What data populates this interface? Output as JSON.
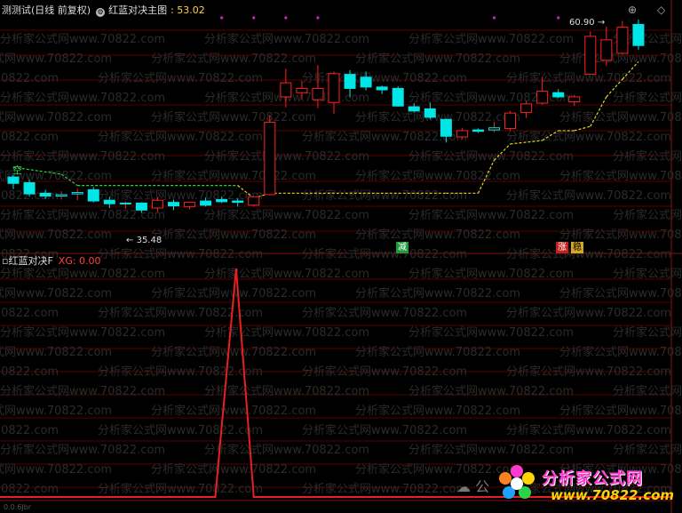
{
  "main_panel": {
    "title_prefix": "测测试(日线 前复权)",
    "indicator_name": "红蓝对决主图",
    "indicator_value_label": ": 53.02",
    "high_label": "60.90",
    "low_label": "35.48",
    "signal_label_kong": "空",
    "marker_jian": "减",
    "marker_zhang": "涨",
    "marker_wen": "稳"
  },
  "sub_panel": {
    "title": "红蓝对决F",
    "value_label": "XG: 0.00"
  },
  "window_controls": {
    "restore": "⊕",
    "close": "◇"
  },
  "watermark": {
    "repeat_text": "分析家公式网www.70822.com",
    "wechat_text": "公",
    "brand": "分析家公式网",
    "site": "www.70822.com"
  },
  "footer_label": "0.0.6Jbr",
  "colors": {
    "up": "#ff2020",
    "down": "#00e5e5",
    "stop_line_green": "#2bd34a",
    "stop_line_yellow": "#e8d420",
    "xg_line": "#e82020",
    "grid": "#5a0000",
    "magenta_dot": "#d020d0"
  },
  "chart_data": {
    "type": "candlestick",
    "candles": [
      {
        "o": 40.6,
        "h": 40.9,
        "l": 38.9,
        "c": 39.7
      },
      {
        "o": 39.8,
        "h": 40.3,
        "l": 37.8,
        "c": 38.2
      },
      {
        "o": 38.3,
        "h": 38.8,
        "l": 37.5,
        "c": 37.9
      },
      {
        "o": 37.9,
        "h": 38.6,
        "l": 37.4,
        "c": 38.1
      },
      {
        "o": 38.2,
        "h": 38.9,
        "l": 37.3,
        "c": 38.4
      },
      {
        "o": 38.8,
        "h": 39.2,
        "l": 37.0,
        "c": 37.2
      },
      {
        "o": 37.3,
        "h": 37.8,
        "l": 36.2,
        "c": 36.8
      },
      {
        "o": 36.8,
        "h": 37.1,
        "l": 36.1,
        "c": 36.9
      },
      {
        "o": 36.9,
        "h": 37.0,
        "l": 35.5,
        "c": 35.9
      },
      {
        "o": 36.2,
        "h": 37.7,
        "l": 35.6,
        "c": 37.3
      },
      {
        "o": 37.0,
        "h": 37.4,
        "l": 35.9,
        "c": 36.5
      },
      {
        "o": 36.4,
        "h": 37.0,
        "l": 36.0,
        "c": 37.0
      },
      {
        "o": 37.2,
        "h": 37.7,
        "l": 36.4,
        "c": 36.6
      },
      {
        "o": 37.4,
        "h": 37.8,
        "l": 36.9,
        "c": 37.1
      },
      {
        "o": 37.2,
        "h": 37.6,
        "l": 36.4,
        "c": 37.0
      },
      {
        "o": 36.6,
        "h": 37.9,
        "l": 36.4,
        "c": 37.8
      },
      {
        "o": 38.1,
        "h": 49.4,
        "l": 38.0,
        "c": 48.4
      },
      {
        "o": 52.0,
        "h": 56.0,
        "l": 50.5,
        "c": 54.0
      },
      {
        "o": 52.6,
        "h": 54.3,
        "l": 51.6,
        "c": 53.2
      },
      {
        "o": 51.6,
        "h": 56.5,
        "l": 50.4,
        "c": 53.2
      },
      {
        "o": 51.2,
        "h": 55.6,
        "l": 49.6,
        "c": 55.3
      },
      {
        "o": 55.2,
        "h": 55.8,
        "l": 51.9,
        "c": 53.2
      },
      {
        "o": 54.8,
        "h": 55.6,
        "l": 52.9,
        "c": 53.4
      },
      {
        "o": 53.4,
        "h": 53.6,
        "l": 52.4,
        "c": 53.0
      },
      {
        "o": 53.2,
        "h": 53.5,
        "l": 50.6,
        "c": 50.7
      },
      {
        "o": 50.6,
        "h": 51.1,
        "l": 49.8,
        "c": 50.0
      },
      {
        "o": 50.3,
        "h": 51.2,
        "l": 48.8,
        "c": 49.1
      },
      {
        "o": 48.8,
        "h": 48.9,
        "l": 45.5,
        "c": 46.4
      },
      {
        "o": 46.3,
        "h": 47.6,
        "l": 46.0,
        "c": 47.2
      },
      {
        "o": 47.3,
        "h": 47.5,
        "l": 46.9,
        "c": 47.1
      },
      {
        "o": 47.3,
        "h": 48.4,
        "l": 47.0,
        "c": 47.6
      },
      {
        "o": 47.5,
        "h": 50.0,
        "l": 47.2,
        "c": 49.7
      },
      {
        "o": 49.8,
        "h": 51.4,
        "l": 49.0,
        "c": 51.0
      },
      {
        "o": 51.1,
        "h": 54.8,
        "l": 50.9,
        "c": 52.8
      },
      {
        "o": 52.6,
        "h": 53.1,
        "l": 51.8,
        "c": 52.0
      },
      {
        "o": 51.3,
        "h": 52.3,
        "l": 50.7,
        "c": 52.0
      },
      {
        "o": 55.2,
        "h": 61.3,
        "l": 55.2,
        "c": 60.6
      },
      {
        "o": 57.2,
        "h": 62.0,
        "l": 56.4,
        "c": 60.1
      },
      {
        "o": 58.2,
        "h": 62.8,
        "l": 58.0,
        "c": 61.9
      },
      {
        "o": 62.3,
        "h": 63.0,
        "l": 58.7,
        "c": 59.3
      }
    ],
    "stop_line": [
      {
        "i": 0,
        "v": 42.0,
        "color": "green"
      },
      {
        "i": 3,
        "v": 41.0,
        "color": "green"
      },
      {
        "i": 4,
        "v": 39.4,
        "color": "green"
      },
      {
        "i": 14,
        "v": 39.4,
        "color": "green"
      },
      {
        "i": 15,
        "v": 37.6,
        "color": "yellow"
      },
      {
        "i": 16,
        "v": 38.3,
        "color": "yellow"
      },
      {
        "i": 27,
        "v": 38.3,
        "color": "yellow"
      },
      {
        "i": 29,
        "v": 38.3,
        "color": "yellow"
      },
      {
        "i": 30,
        "v": 43.0,
        "color": "yellow"
      },
      {
        "i": 31,
        "v": 45.3,
        "color": "yellow"
      },
      {
        "i": 33,
        "v": 45.8,
        "color": "yellow"
      },
      {
        "i": 34,
        "v": 47.2,
        "color": "yellow"
      },
      {
        "i": 35,
        "v": 47.2,
        "color": "yellow"
      },
      {
        "i": 36,
        "v": 47.8,
        "color": "yellow"
      },
      {
        "i": 37,
        "v": 52.0,
        "color": "yellow"
      },
      {
        "i": 38,
        "v": 54.5,
        "color": "yellow"
      },
      {
        "i": 39,
        "v": 57.0,
        "color": "yellow"
      }
    ],
    "xg": [
      0,
      0,
      0,
      0,
      0,
      0,
      0,
      0,
      0,
      0,
      0,
      0,
      0,
      0,
      0,
      0,
      0,
      0,
      0,
      0,
      0,
      0,
      0,
      0,
      0,
      0,
      0,
      0,
      0,
      0,
      0,
      0,
      0,
      0,
      0,
      0,
      0,
      0,
      0,
      0
    ],
    "xg_spike": {
      "from_index": 12.6,
      "peak_index": 13.9,
      "to_index": 15.0,
      "value": 1
    },
    "magenta_dots": [
      13,
      15,
      17,
      19,
      30,
      34
    ]
  }
}
